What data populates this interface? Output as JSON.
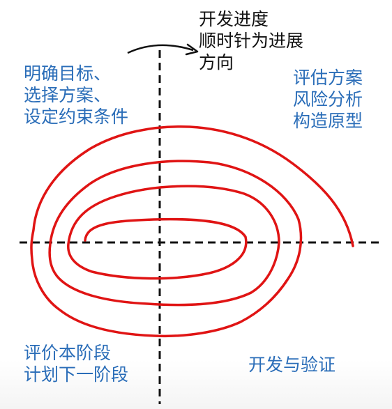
{
  "colors": {
    "spiral": "#e01414",
    "axes": "#111111",
    "quadrant_text": "#2a6db8",
    "direction_text": "#111111"
  },
  "direction": {
    "lines": [
      "开发进度",
      "顺时针为进展",
      "方向"
    ]
  },
  "quadrants": {
    "top_left": {
      "lines": [
        "明确目标、",
        "选择方案、",
        "设定约束条件"
      ]
    },
    "top_right": {
      "lines": [
        "评估方案",
        "风险分析",
        "构造原型"
      ]
    },
    "bottom_left": {
      "lines": [
        "评价本阶段",
        "计划下一阶段"
      ]
    },
    "bottom_right": {
      "lines": [
        "开发与验证"
      ]
    }
  }
}
